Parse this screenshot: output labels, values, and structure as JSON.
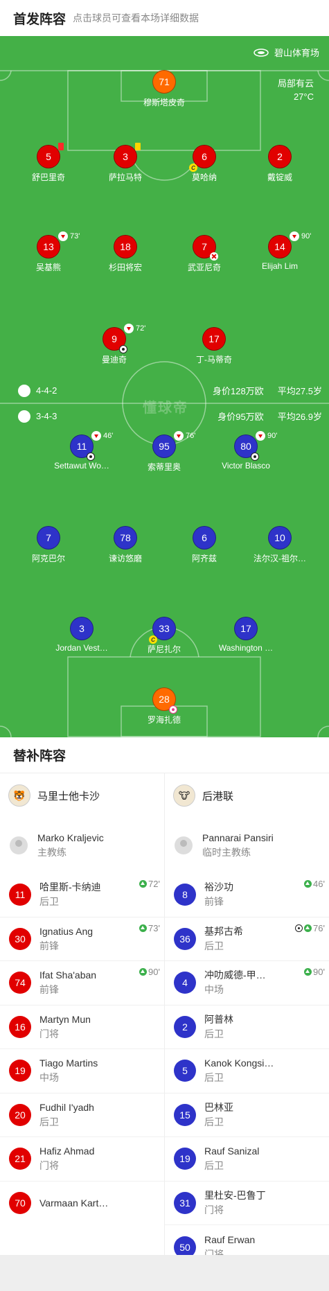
{
  "header": {
    "title": "首发阵容",
    "subtitle": "点击球员可查看本场详细数据"
  },
  "pitch": {
    "venue": "碧山体育场",
    "weather": "局部有云",
    "temperature": "27°C",
    "watermark": "懂球帝",
    "home_info": {
      "formation": "4-4-2",
      "value": "身价128万欧",
      "avg_age": "平均27.5岁"
    },
    "away_info": {
      "formation": "3-4-3",
      "value": "身价95万欧",
      "avg_age": "平均26.9岁"
    },
    "home_players": [
      {
        "num": "71",
        "name": "穆斯塔皮奇"
      },
      {
        "num": "5",
        "name": "舒巴里奇"
      },
      {
        "num": "3",
        "name": "萨拉马特"
      },
      {
        "num": "6",
        "name": "莫哈纳"
      },
      {
        "num": "2",
        "name": "戴锭威"
      },
      {
        "num": "13",
        "name": "吴基熊",
        "sub": "73'"
      },
      {
        "num": "18",
        "name": "杉田将宏"
      },
      {
        "num": "7",
        "name": "武亚尼奇"
      },
      {
        "num": "14",
        "name": "Elijah Lim",
        "sub": "90'"
      },
      {
        "num": "9",
        "name": "曼迪奇",
        "sub": "72'"
      },
      {
        "num": "17",
        "name": "丁-马蒂奇"
      }
    ],
    "away_players": [
      {
        "num": "11",
        "name": "Settawut Wo…",
        "sub": "46'"
      },
      {
        "num": "95",
        "name": "索蒂里奥",
        "sub": "76'"
      },
      {
        "num": "80",
        "name": "Victor Blasco",
        "sub": "90'"
      },
      {
        "num": "7",
        "name": "阿克巴尔"
      },
      {
        "num": "78",
        "name": "谏访悠磨"
      },
      {
        "num": "6",
        "name": "阿齐兹"
      },
      {
        "num": "10",
        "name": "法尔汉-祖尔…"
      },
      {
        "num": "3",
        "name": "Jordan Vest…"
      },
      {
        "num": "33",
        "name": "萨尼扎尔"
      },
      {
        "num": "17",
        "name": "Washington …"
      },
      {
        "num": "28",
        "name": "罗海扎德"
      }
    ]
  },
  "subs": {
    "title": "替补阵容",
    "home": {
      "team": "马里士他卡沙",
      "coach": {
        "name": "Marko Kraljevic",
        "role": "主教练"
      },
      "players": [
        {
          "num": "11",
          "name": "哈里斯-卡纳迪",
          "pos": "后卫",
          "in": "72'"
        },
        {
          "num": "30",
          "name": "Ignatius Ang",
          "pos": "前锋",
          "in": "73'"
        },
        {
          "num": "74",
          "name": "Ifat Sha'aban",
          "pos": "前锋",
          "in": "90'"
        },
        {
          "num": "16",
          "name": "Martyn Mun",
          "pos": "门将",
          "in": ""
        },
        {
          "num": "19",
          "name": "Tiago Martins",
          "pos": "中场",
          "in": ""
        },
        {
          "num": "20",
          "name": "Fudhil I'yadh",
          "pos": "后卫",
          "in": ""
        },
        {
          "num": "21",
          "name": "Hafiz Ahmad",
          "pos": "门将",
          "in": ""
        },
        {
          "num": "70",
          "name": "Varmaan Kart…",
          "pos": "",
          "in": ""
        }
      ]
    },
    "away": {
      "team": "后港联",
      "coach": {
        "name": "Pannarai Pansiri",
        "role": "临时主教练"
      },
      "players": [
        {
          "num": "8",
          "name": "裕沙功",
          "pos": "前锋",
          "in": "46'"
        },
        {
          "num": "36",
          "name": "基邦古希",
          "pos": "后卫",
          "in": "76'"
        },
        {
          "num": "4",
          "name": "冲叻威德-甲…",
          "pos": "中场",
          "in": "90'"
        },
        {
          "num": "2",
          "name": "阿普林",
          "pos": "后卫",
          "in": ""
        },
        {
          "num": "5",
          "name": "Kanok Kongsi…",
          "pos": "后卫",
          "in": ""
        },
        {
          "num": "15",
          "name": "巴林亚",
          "pos": "后卫",
          "in": ""
        },
        {
          "num": "19",
          "name": "Rauf Sanizal",
          "pos": "后卫",
          "in": ""
        },
        {
          "num": "31",
          "name": "里杜安-巴鲁丁",
          "pos": "门将",
          "in": ""
        },
        {
          "num": "50",
          "name": "Rauf Erwan",
          "pos": "门将",
          "in": ""
        }
      ]
    }
  }
}
